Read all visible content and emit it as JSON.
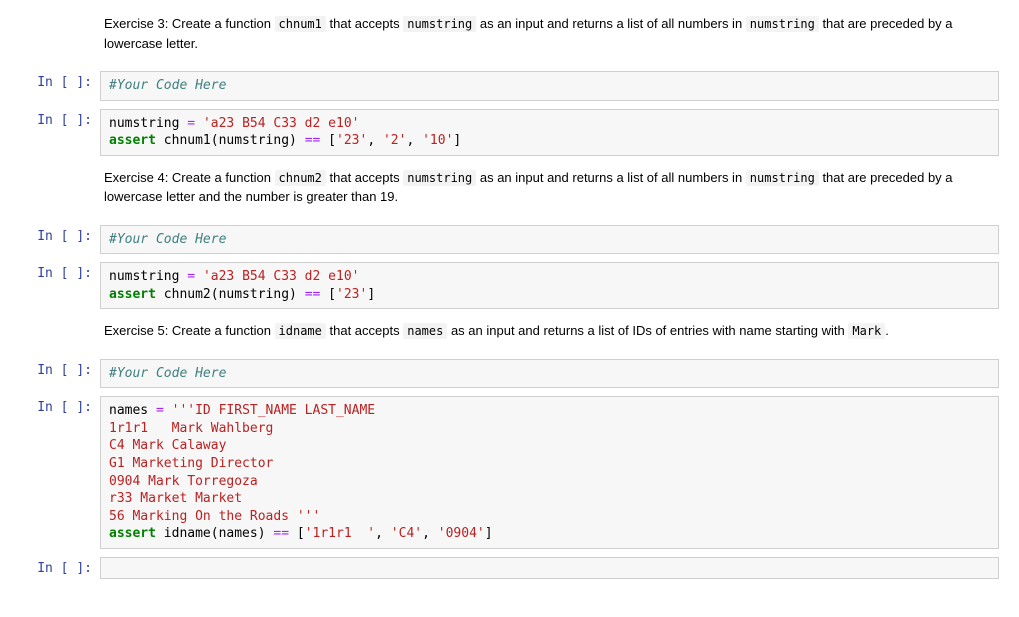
{
  "prompts": {
    "in_empty": "In [ ]:"
  },
  "md": {
    "ex3": {
      "t1": "Exercise 3: Create a function ",
      "c1": "chnum1",
      "t2": " that accepts ",
      "c2": "numstring",
      "t3": " as an input and returns a list of all numbers in ",
      "c3": "numstring",
      "t4": " that are preceded by a lowercase letter."
    },
    "ex4": {
      "t1": "Exercise 4: Create a function ",
      "c1": "chnum2",
      "t2": " that accepts ",
      "c2": "numstring",
      "t3": " as an input and returns a list of all numbers in ",
      "c3": "numstring",
      "t4": " that are preceded by a lowercase letter and the number is greater than 19."
    },
    "ex5": {
      "t1": "Exercise 5: Create a function ",
      "c1": "idname",
      "t2": " that accepts ",
      "c2": "names",
      "t3": " as an input and returns a list of IDs of entries with name starting with ",
      "c3": "Mark",
      "t4": "."
    }
  },
  "code": {
    "your_code_here": "#Your Code Here",
    "c3b": {
      "l1_a": "numstring ",
      "l1_b": "= ",
      "l1_c": "'a23 B54 C33 d2 e10'",
      "l2_a": "assert",
      "l2_b": " chnum1(numstring) ",
      "l2_c": "==",
      "l2_d": " [",
      "l2_e": "'23'",
      "l2_f": ", ",
      "l2_g": "'2'",
      "l2_h": ", ",
      "l2_i": "'10'",
      "l2_j": "]"
    },
    "c4b": {
      "l1_a": "numstring ",
      "l1_b": "= ",
      "l1_c": "'a23 B54 C33 d2 e10'",
      "l2_a": "assert",
      "l2_b": " chnum2(numstring) ",
      "l2_c": "==",
      "l2_d": " [",
      "l2_e": "'23'",
      "l2_f": "]"
    },
    "c5b": {
      "l1_a": "names ",
      "l1_b": "= ",
      "l1_c": "'''ID FIRST_NAME LAST_NAME",
      "l2": "1r1r1   Mark Wahlberg",
      "l3": "C4 Mark Calaway",
      "l4": "G1 Marketing Director",
      "l5": "0904 Mark Torregoza",
      "l6": "r33 Market Market",
      "l7": "56 Marking On the Roads '''",
      "l8_a": "assert",
      "l8_b": " idname(names) ",
      "l8_c": "==",
      "l8_d": " [",
      "l8_e": "'1r1r1  '",
      "l8_f": ", ",
      "l8_g": "'C4'",
      "l8_h": ", ",
      "l8_i": "'0904'",
      "l8_j": "]"
    }
  }
}
